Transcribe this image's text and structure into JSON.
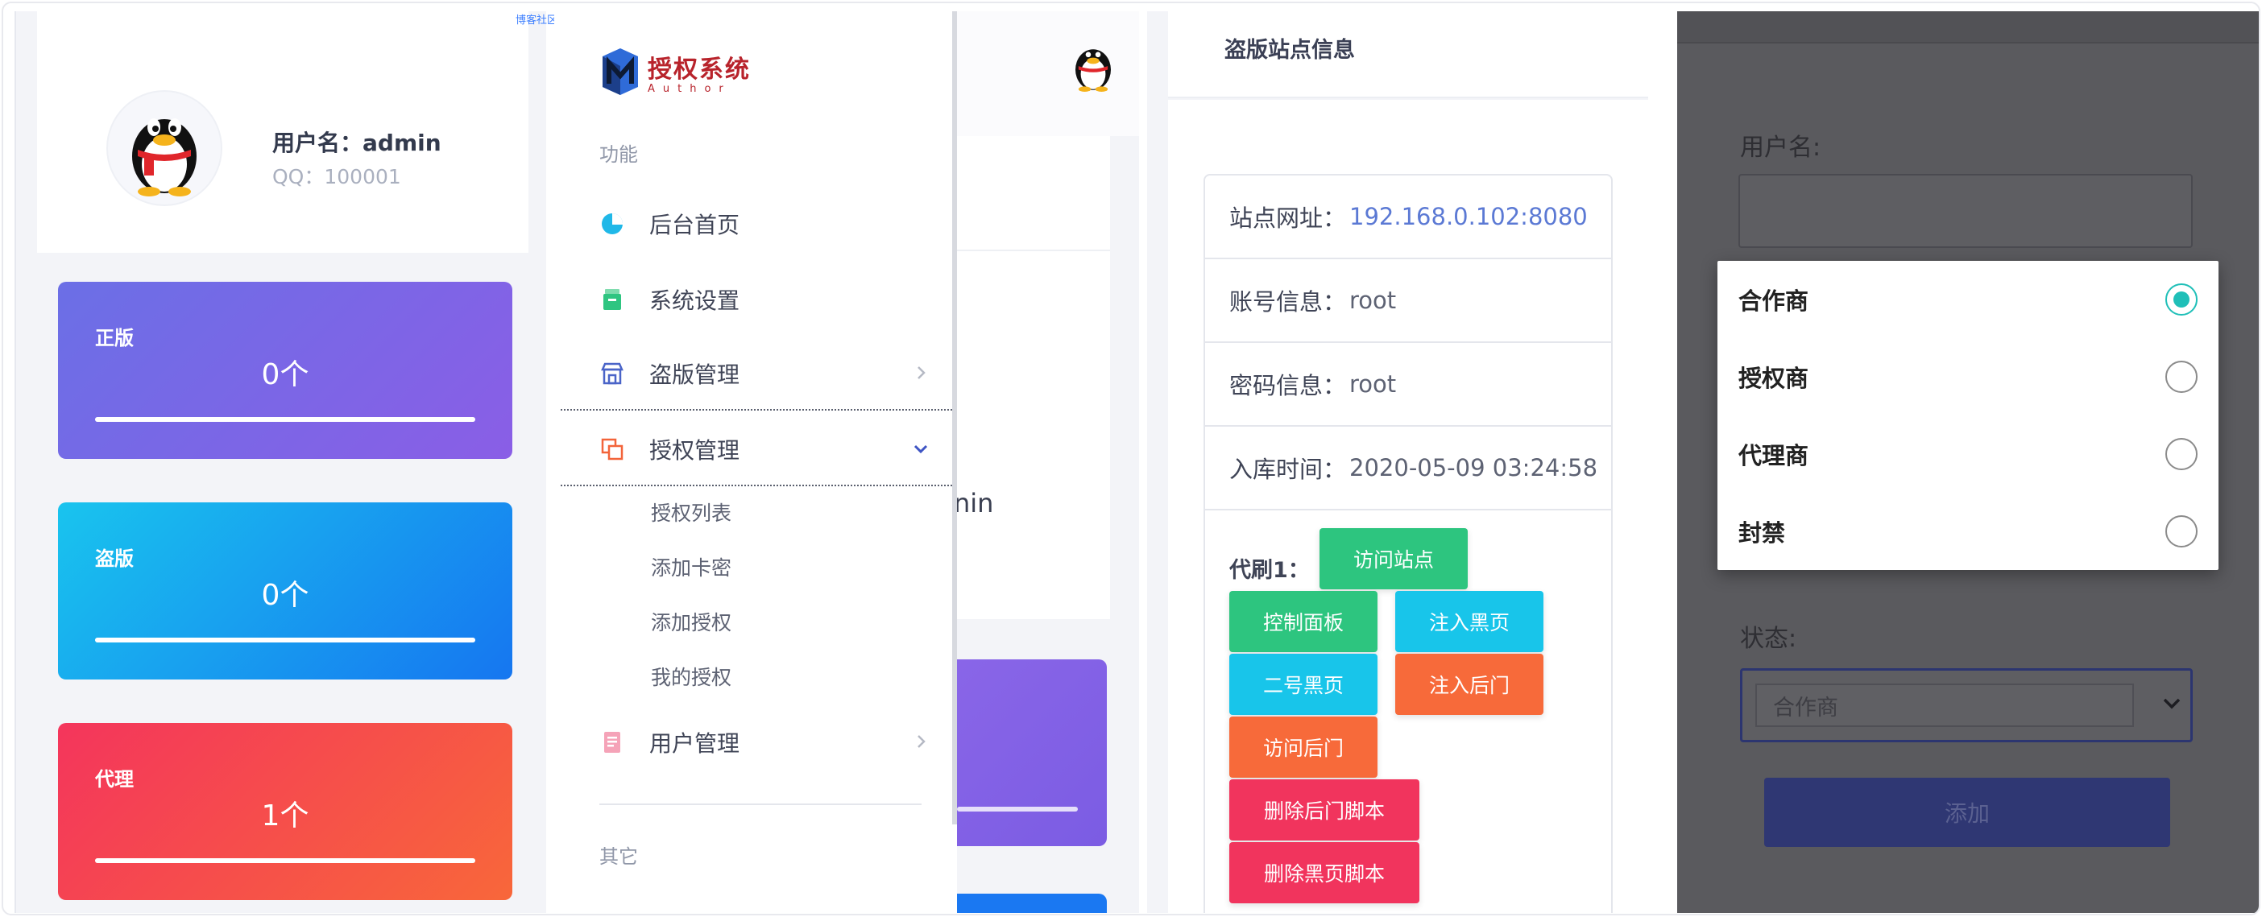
{
  "watermark": "博客社区",
  "profile": {
    "username": "用户名：admin",
    "qq": "QQ：100001"
  },
  "stats": [
    {
      "title": "正版",
      "value": "0个",
      "progress": 1.0,
      "from": "#6b6fe6",
      "to": "#8a5ee6"
    },
    {
      "title": "盗版",
      "value": "0个",
      "progress": 1.0,
      "from": "#19c4ee",
      "to": "#1676f0"
    },
    {
      "title": "代理",
      "value": "1个",
      "progress": 1.0,
      "from": "#f4355c",
      "to": "#f8673a"
    }
  ],
  "sidebar": {
    "logo_cn": "授权系统",
    "logo_en": "Author",
    "section_func": "功能",
    "items": [
      {
        "label": "后台首页",
        "icon": "pie-chart-icon"
      },
      {
        "label": "系统设置",
        "icon": "archive-icon"
      },
      {
        "label": "盗版管理",
        "icon": "store-icon"
      },
      {
        "label": "授权管理",
        "icon": "copy-icon"
      },
      {
        "label": "用户管理",
        "icon": "document-icon"
      }
    ],
    "sub_items": [
      "授权列表",
      "添加卡密",
      "添加授权",
      "我的授权"
    ],
    "section_other": "其它",
    "background_fragment": "nin"
  },
  "pirate_site": {
    "title": "盗版站点信息",
    "rows": [
      {
        "label": "站点网址：",
        "value": "192.168.0.102:8080"
      },
      {
        "label": "账号信息：",
        "value": "root"
      },
      {
        "label": "密码信息：",
        "value": "root"
      },
      {
        "label": "入库时间：",
        "value": "2020-05-09 03:24:58"
      }
    ],
    "code_label": "代刷1：",
    "buttons": [
      {
        "label": "访问站点",
        "color": "#2dc57f"
      },
      {
        "label": "控制面板",
        "color": "#2dc57f"
      },
      {
        "label": "注入黑页",
        "color": "#18c5ea"
      },
      {
        "label": "二号黑页",
        "color": "#18c5ea"
      },
      {
        "label": "注入后门",
        "color": "#f76a3a"
      },
      {
        "label": "访问后门",
        "color": "#f76a3a"
      },
      {
        "label": "删除后门脚本",
        "color": "#f1345d"
      },
      {
        "label": "删除黑页脚本",
        "color": "#f1345d"
      }
    ]
  },
  "add_form": {
    "username_label": "用户名:",
    "status_label": "状态:",
    "select_value": "合作商",
    "add_button": "添加",
    "options": [
      {
        "label": "合作商",
        "selected": true
      },
      {
        "label": "授权商",
        "selected": false
      },
      {
        "label": "代理商",
        "selected": false
      },
      {
        "label": "封禁",
        "selected": false
      }
    ]
  }
}
